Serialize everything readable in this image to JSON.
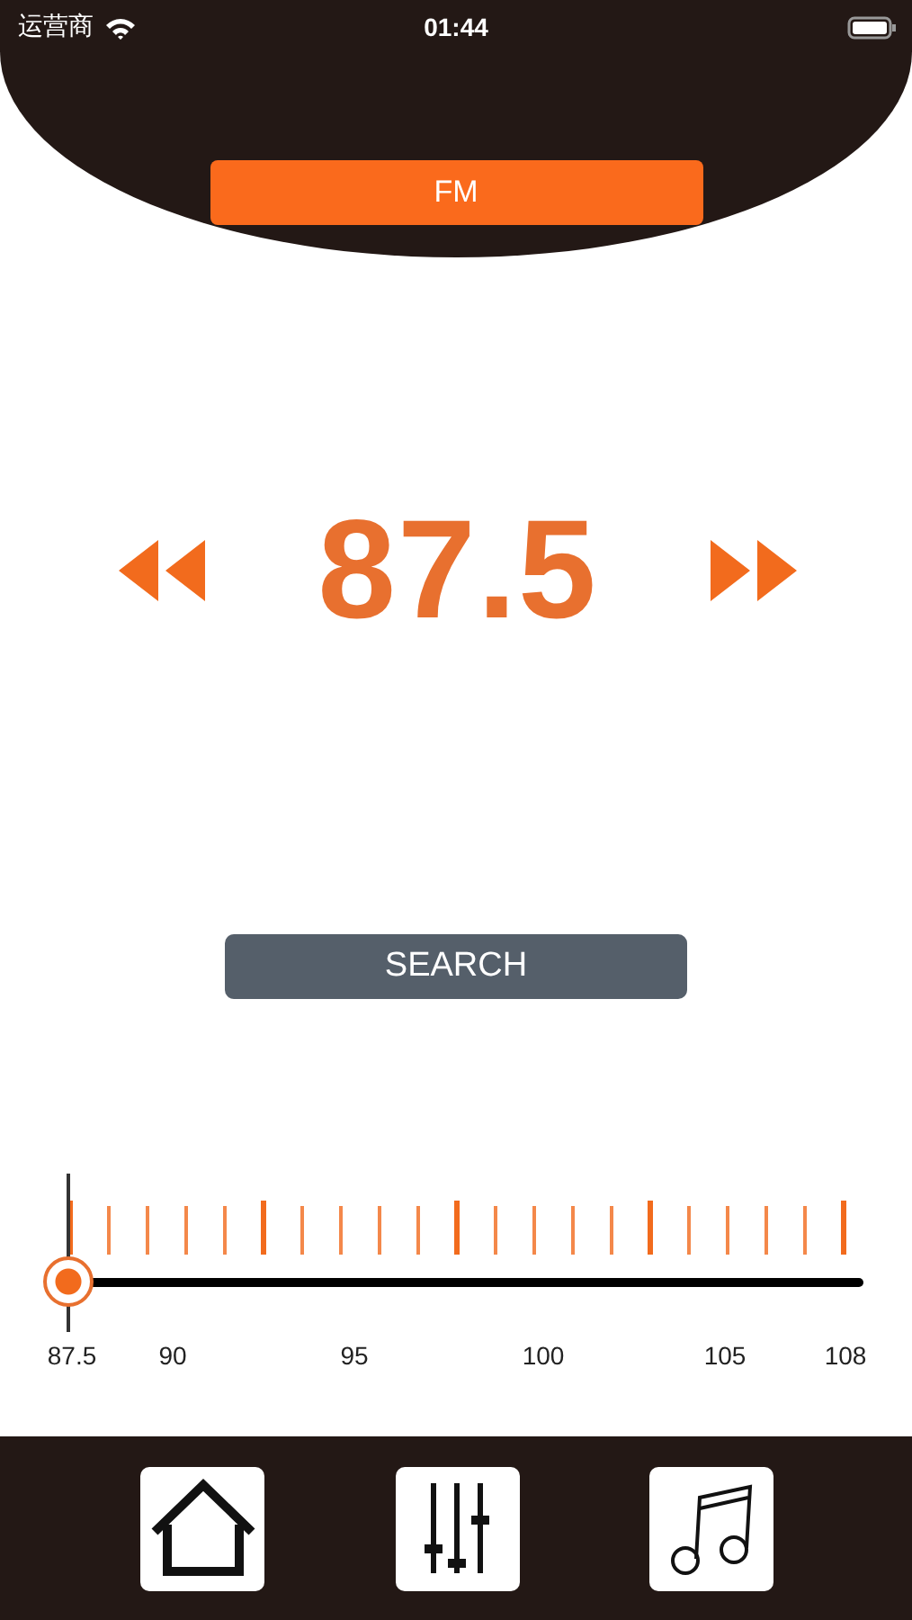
{
  "status_bar": {
    "carrier": "运营商",
    "time": "01:44"
  },
  "band_button": {
    "label": "FM"
  },
  "frequency": {
    "value": "87.5"
  },
  "search_button": {
    "label": "SEARCH"
  },
  "tuner": {
    "level": 0,
    "scale_labels": [
      "87.5",
      "90",
      "95",
      "100",
      "105",
      "108"
    ]
  },
  "tab_bar": {
    "items": [
      {
        "kind": "home"
      },
      {
        "kind": "equalizer"
      },
      {
        "kind": "music"
      }
    ]
  }
}
